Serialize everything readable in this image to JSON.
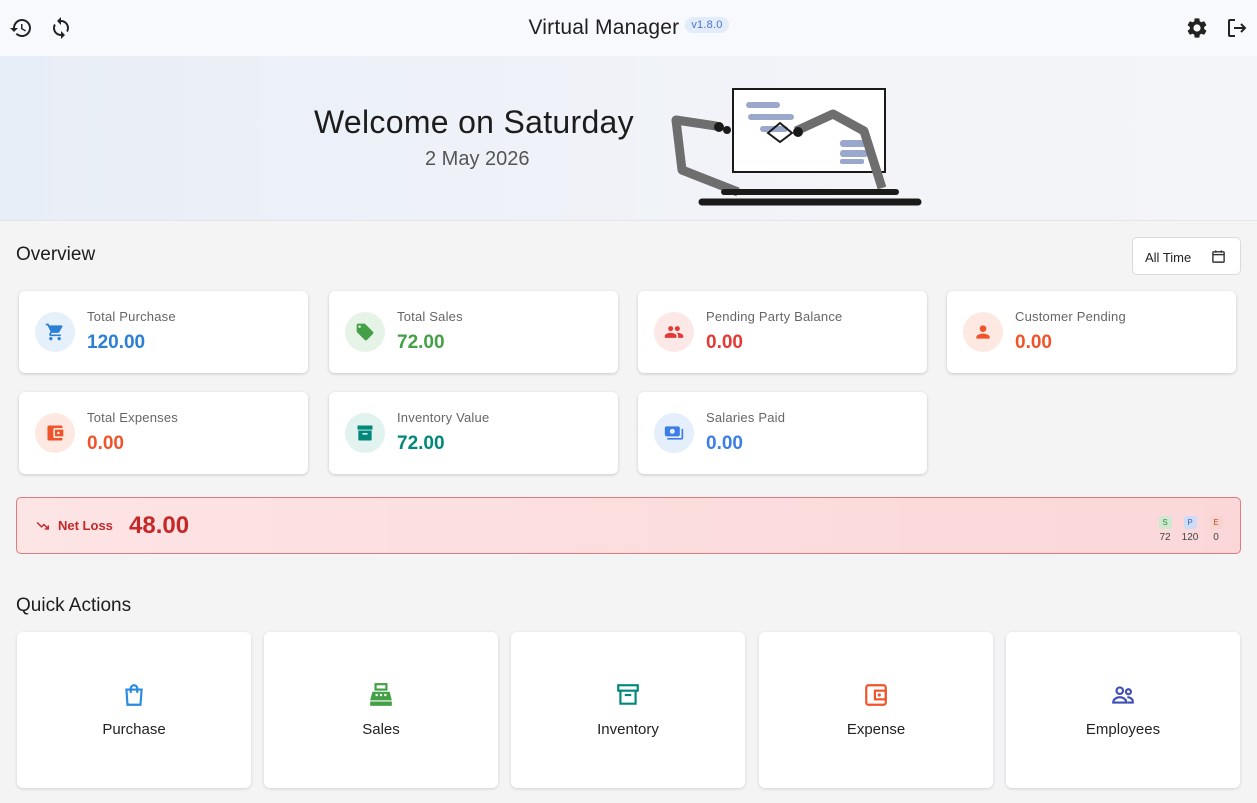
{
  "app": {
    "title": "Virtual Manager",
    "version": "v1.8.0"
  },
  "topbar": {
    "left_icons": [
      "history-icon",
      "sync-icon"
    ],
    "right_icons": [
      "settings-icon",
      "logout-icon"
    ]
  },
  "hero": {
    "welcome": "Welcome on Saturday",
    "date": "2 May 2026"
  },
  "overview": {
    "title": "Overview",
    "filter_label": "All Time",
    "cards": [
      {
        "label": "Total Purchase",
        "value": "120.00",
        "color": "#2b7fd4",
        "bg": "#e6f0fb",
        "icon": "cart-icon"
      },
      {
        "label": "Total Sales",
        "value": "72.00",
        "color": "#43a047",
        "bg": "#e6f4e7",
        "icon": "tag-icon"
      },
      {
        "label": "Pending Party Balance",
        "value": "0.00",
        "color": "#e53935",
        "bg": "#fde8e8",
        "icon": "group-icon"
      },
      {
        "label": "Customer Pending",
        "value": "0.00",
        "color": "#f0542a",
        "bg": "#fde9e2",
        "icon": "person-icon"
      },
      {
        "label": "Total Expenses",
        "value": "0.00",
        "color": "#f0542a",
        "bg": "#fde9e2",
        "icon": "wallet-icon"
      },
      {
        "label": "Inventory Value",
        "value": "72.00",
        "color": "#00897b",
        "bg": "#e1f2ef",
        "icon": "archive-icon"
      },
      {
        "label": "Salaries Paid",
        "value": "0.00",
        "color": "#3d7ee6",
        "bg": "#e5eefb",
        "icon": "money-icon"
      }
    ]
  },
  "net": {
    "label": "Net Loss",
    "value": "48.00",
    "mini": [
      {
        "badge": "S",
        "value": "72",
        "bg": "#cfe8cf",
        "fg": "#3a8a3a"
      },
      {
        "badge": "P",
        "value": "120",
        "bg": "#cfdcf5",
        "fg": "#3d68b8"
      },
      {
        "badge": "E",
        "value": "0",
        "bg": "#f7d4cd",
        "fg": "#c64a2f"
      }
    ]
  },
  "quick_actions": {
    "title": "Quick Actions",
    "items": [
      {
        "label": "Purchase",
        "icon": "shopping-bag-icon",
        "color": "#2b8be0"
      },
      {
        "label": "Sales",
        "icon": "cash-register-icon",
        "color": "#43a047"
      },
      {
        "label": "Inventory",
        "icon": "archive-icon",
        "color": "#00897b"
      },
      {
        "label": "Expense",
        "icon": "wallet-icon",
        "color": "#f0542a"
      },
      {
        "label": "Employees",
        "icon": "group-icon",
        "color": "#3f4fb5"
      }
    ]
  }
}
